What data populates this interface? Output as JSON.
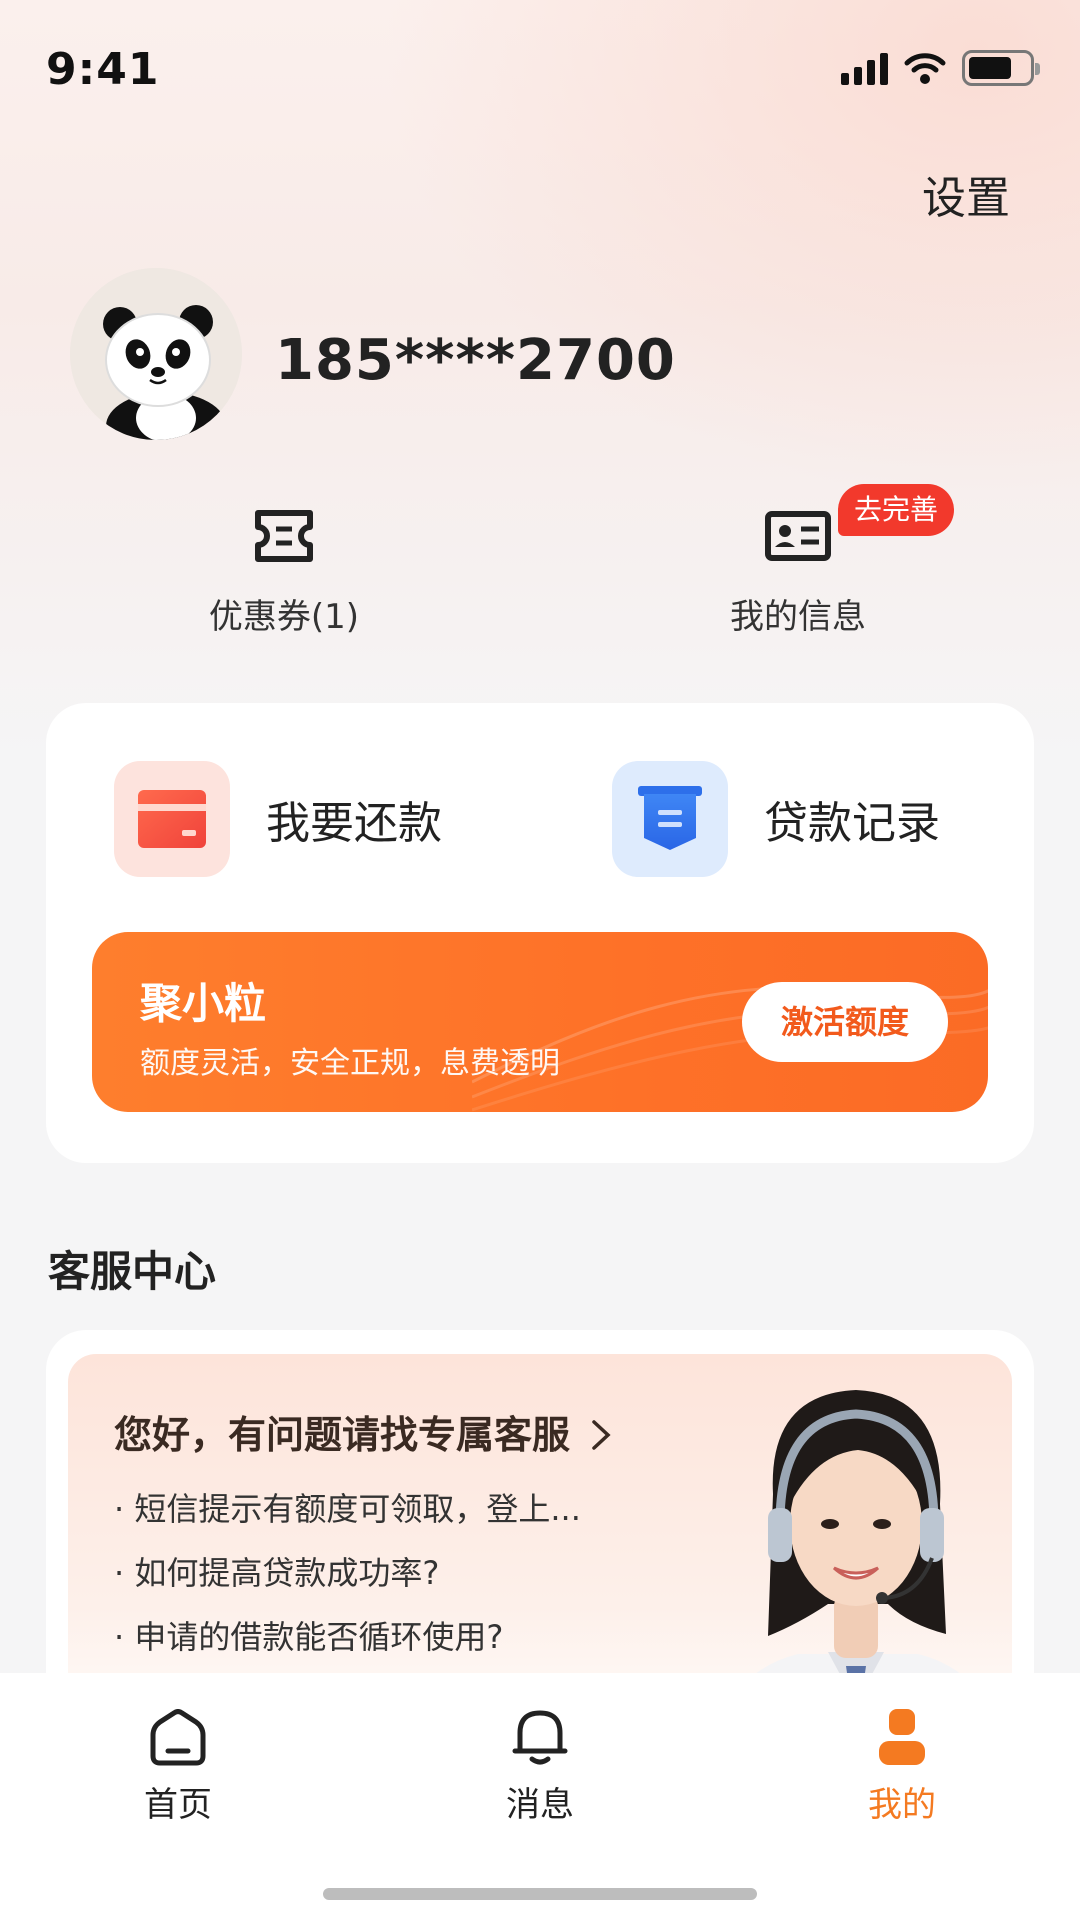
{
  "status_bar": {
    "time": "9:41"
  },
  "header": {
    "settings_label": "设置"
  },
  "profile": {
    "phone": "185****2700"
  },
  "shortcuts": [
    {
      "label": "优惠券(1)",
      "icon": "ticket-icon"
    },
    {
      "label": "我的信息",
      "icon": "id-card-icon",
      "badge": "去完善"
    }
  ],
  "actions": [
    {
      "label": "我要还款",
      "icon": "card-icon"
    },
    {
      "label": "贷款记录",
      "icon": "document-icon"
    }
  ],
  "promo": {
    "title": "聚小粒",
    "subtitle": "额度灵活，安全正规，息费透明",
    "button": "激活额度"
  },
  "customer_service": {
    "section_title": "客服中心",
    "greeting": "您好，有问题请找专属客服",
    "questions": [
      "· 短信提示有额度可领取，登上...",
      "· 如何提高贷款成功率?",
      "· 申请的借款能否循环使用?"
    ]
  },
  "tabs": [
    {
      "label": "首页",
      "icon": "home-icon",
      "active": false
    },
    {
      "label": "消息",
      "icon": "bell-icon",
      "active": false
    },
    {
      "label": "我的",
      "icon": "person-icon",
      "active": true
    }
  ],
  "colors": {
    "accent": "#fe7128",
    "active_tab": "#f47a21",
    "badge": "#f2392c"
  }
}
